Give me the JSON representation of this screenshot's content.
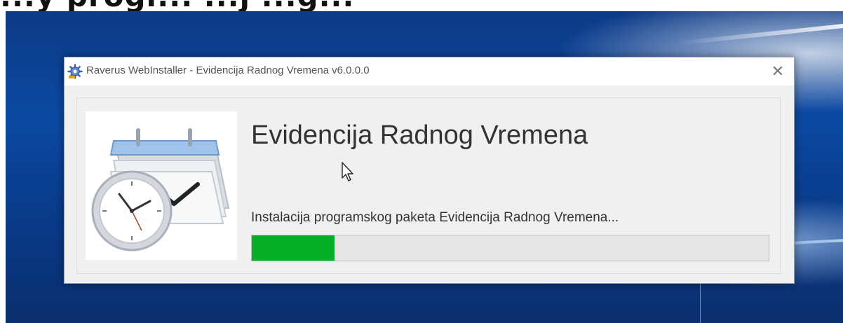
{
  "page": {
    "heading_fragment": "...y progr... ...j ...g..."
  },
  "window": {
    "title": "Raverus WebInstaller - Evidencija Radnog Vremena v6.0.0.0",
    "title_icon": "gear-icon",
    "close_glyph": "✕"
  },
  "installer": {
    "app_name": "Evidencija Radnog Vremena",
    "status": "Instalacija programskog paketa Evidencija Radnog Vremena...",
    "progress_fraction": 0.16,
    "progress_color": "#06b025",
    "image_icon": "calendar-clock-icon"
  },
  "colors": {
    "desktop_blue": "#0b4aa3",
    "window_bg": "#f0f0f0"
  }
}
